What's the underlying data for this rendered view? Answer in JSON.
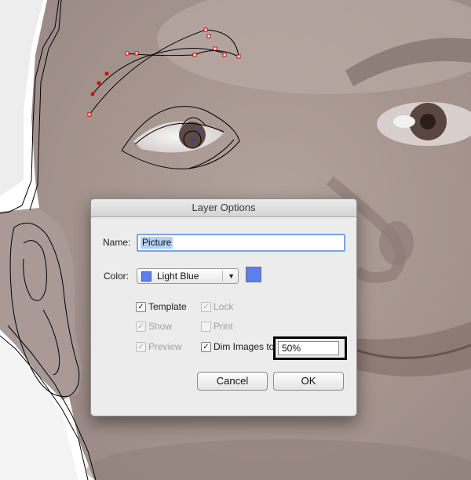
{
  "dialog": {
    "title": "Layer Options",
    "name_label": "Name:",
    "name_value": "Picture",
    "color_label": "Color:",
    "color_value": "Light Blue",
    "color_hex": "#5b7fef",
    "options": {
      "template": {
        "label": "Template",
        "checked": true,
        "enabled": true
      },
      "lock": {
        "label": "Lock",
        "checked": true,
        "enabled": false
      },
      "show": {
        "label": "Show",
        "checked": true,
        "enabled": false
      },
      "print": {
        "label": "Print",
        "checked": false,
        "enabled": false
      },
      "preview": {
        "label": "Preview",
        "checked": true,
        "enabled": false
      },
      "dim_images": {
        "label": "Dim Images to:",
        "checked": true,
        "enabled": true,
        "value": "50%"
      }
    },
    "cancel_label": "Cancel",
    "ok_label": "OK",
    "check_glyph": "✓"
  },
  "icons": {
    "dropdown": "chevron-down-icon"
  }
}
